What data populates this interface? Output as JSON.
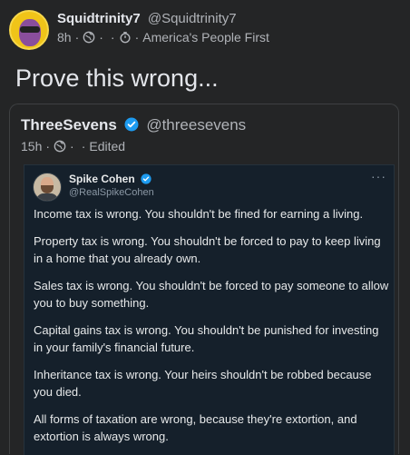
{
  "post": {
    "author_name": "Squidtrinity7",
    "author_handle": "@Squidtrinity7",
    "time": "8h",
    "dot": "·",
    "dot2": "·",
    "dot3": "·",
    "group": "America's People First",
    "text": "Prove this wrong..."
  },
  "quote": {
    "author_name": "ThreeSevens",
    "author_handle": "@threesevens",
    "time": "15h",
    "dot": "·",
    "dot2": "·",
    "edited": "Edited"
  },
  "embed": {
    "author_name": "Spike Cohen",
    "author_handle": "@RealSpikeCohen",
    "more": "···",
    "paragraphs": [
      "Income tax is wrong. You shouldn't be fined for earning a living.",
      "Property tax is wrong. You shouldn't be forced to pay to keep living in a home that you already own.",
      "Sales tax is wrong. You shouldn't be forced to pay someone to allow you to buy something.",
      "Capital gains tax is wrong. You shouldn't be punished for investing in your family's financial future.",
      "Inheritance tax is wrong. Your heirs shouldn't be robbed because you died.",
      "All forms of taxation are wrong, because they're extortion, and extortion is always wrong."
    ]
  },
  "colors": {
    "background": "#242526",
    "embed_background": "#15202b",
    "verified": "#1d9bf0",
    "avatar_ring": "#f0c419"
  },
  "icons": {
    "privacy": "globe-icon",
    "group": "group-icon",
    "verified": "verified-badge-icon"
  }
}
